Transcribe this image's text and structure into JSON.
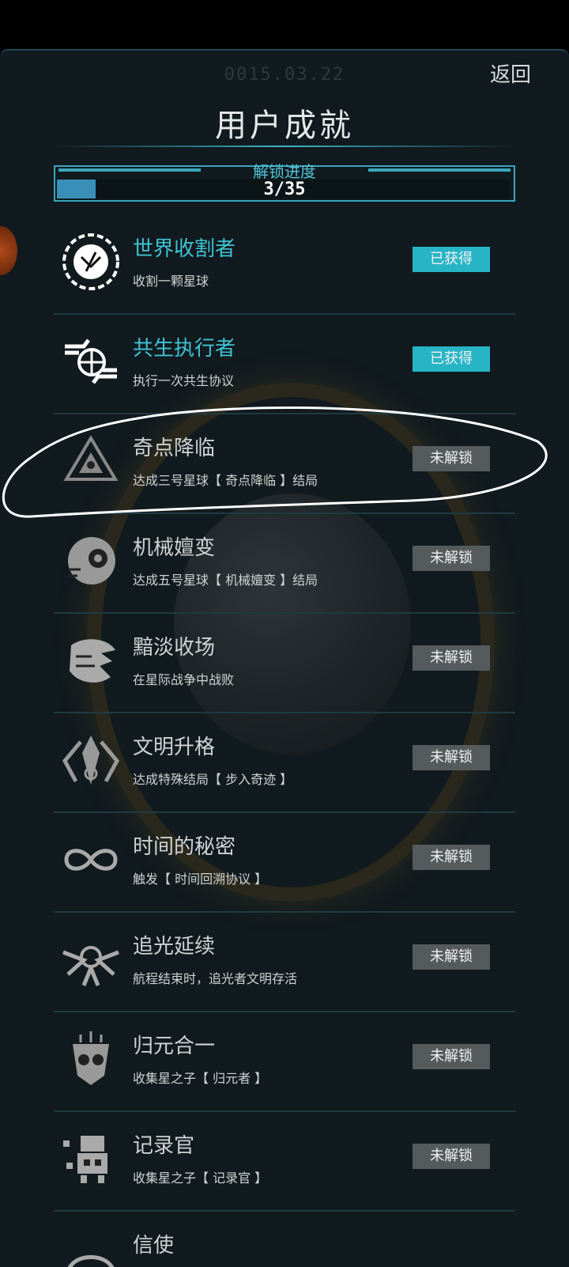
{
  "header": {
    "date": "0015.03.22",
    "back_label": "返回",
    "title": "用户成就"
  },
  "progress": {
    "label": "解锁进度",
    "text": "3/35",
    "fraction": 0.0857
  },
  "achievements": [
    {
      "name": "世界收割者",
      "desc": "收割一颗星球",
      "status": "已获得",
      "unlocked": true,
      "icon": "planet-harvest-icon"
    },
    {
      "name": "共生执行者",
      "desc": "执行一次共生协议",
      "status": "已获得",
      "unlocked": true,
      "icon": "symbiosis-globe-hands-icon"
    },
    {
      "name": "奇点降临",
      "desc": "达成三号星球【 奇点降临 】结局",
      "status": "未解锁",
      "unlocked": false,
      "icon": "singularity-triangle-icon"
    },
    {
      "name": "机械嬗变",
      "desc": "达成五号星球【 机械嬗变 】结局",
      "status": "未解锁",
      "unlocked": false,
      "icon": "mechanical-eye-icon"
    },
    {
      "name": "黯淡收场",
      "desc": "在星际战争中战败",
      "status": "未解锁",
      "unlocked": false,
      "icon": "shattered-planet-icon"
    },
    {
      "name": "文明升格",
      "desc": "达成特殊结局【 步入奇迹 】",
      "status": "未解锁",
      "unlocked": false,
      "icon": "winged-emblem-icon"
    },
    {
      "name": "时间的秘密",
      "desc": "触发【 时间回溯协议 】",
      "status": "未解锁",
      "unlocked": false,
      "icon": "infinity-icon"
    },
    {
      "name": "追光延续",
      "desc": "航程结束时，追光者文明存活",
      "status": "未解锁",
      "unlocked": false,
      "icon": "light-chaser-wings-icon"
    },
    {
      "name": "归元合一",
      "desc": "收集星之子【 归元者 】",
      "status": "未解锁",
      "unlocked": false,
      "icon": "mask-face-icon"
    },
    {
      "name": "记录官",
      "desc": "收集星之子【 记录官 】",
      "status": "未解锁",
      "unlocked": false,
      "icon": "pixel-robot-icon"
    },
    {
      "name": "信使",
      "desc": "",
      "status": "",
      "unlocked": false,
      "icon": "messenger-icon"
    }
  ],
  "colors": {
    "accent": "#3fc3d6",
    "unlocked_badge": "#27b5c6",
    "locked_badge": "#555b5d",
    "background": "#111a1e"
  }
}
